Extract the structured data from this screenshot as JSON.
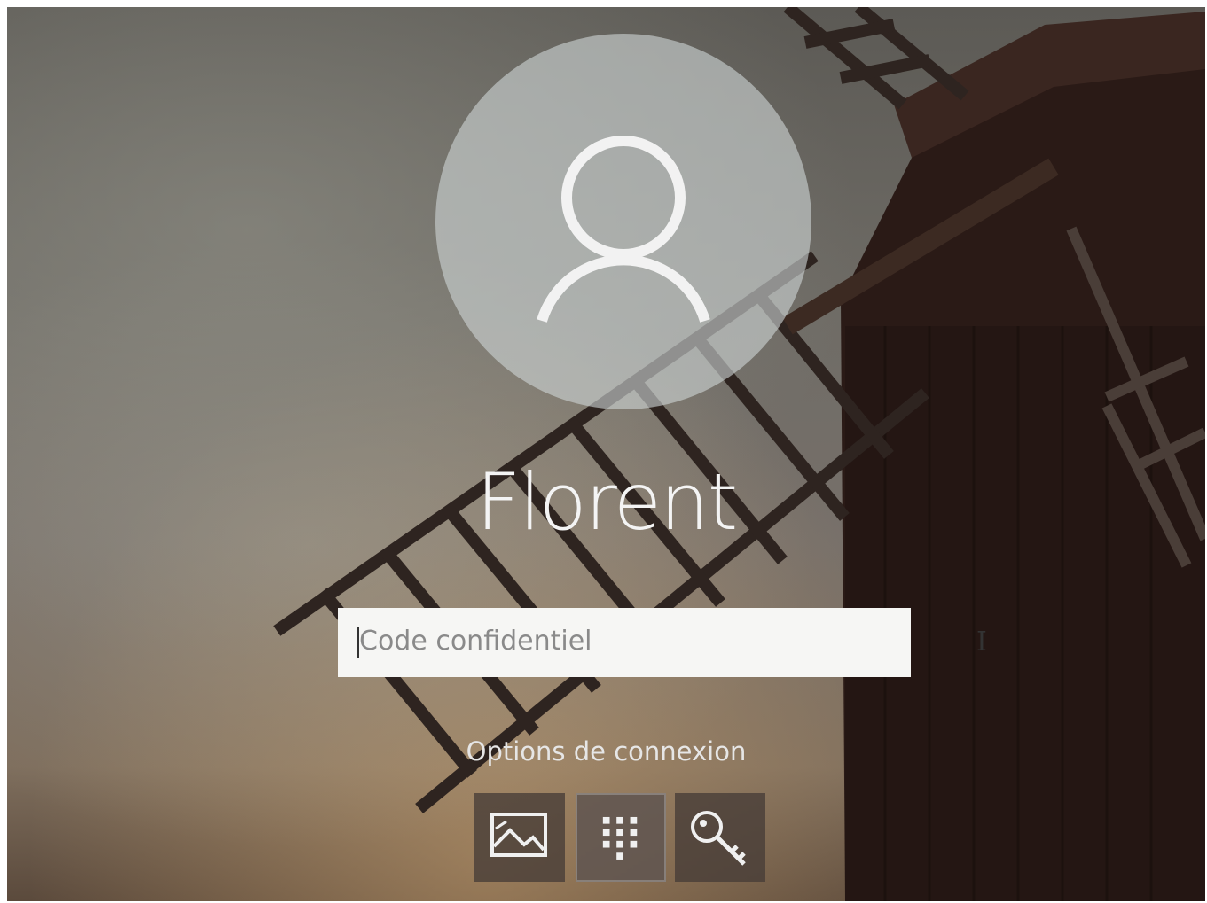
{
  "user": {
    "name": "Florent"
  },
  "pin_field": {
    "placeholder": "Code confidentiel",
    "value": ""
  },
  "sign_in_options": {
    "label": "Options de connexion",
    "methods": [
      {
        "icon": "picture-password-icon",
        "selected": false
      },
      {
        "icon": "pin-keypad-icon",
        "selected": true
      },
      {
        "icon": "key-icon",
        "selected": false
      }
    ]
  },
  "colors": {
    "text_light": "#f4f4f4",
    "avatar_bg": "#cdd4d4",
    "field_bg": "#f6f6f4",
    "button_bg": "#463c37"
  }
}
